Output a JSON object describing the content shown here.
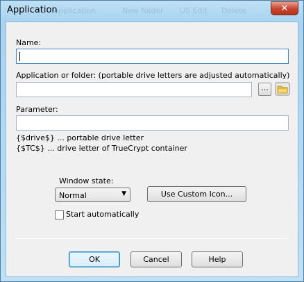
{
  "window": {
    "title": "Application",
    "background_ghost": [
      "Application",
      "New folder",
      "US Edit",
      "Delete"
    ]
  },
  "form": {
    "name_label": "Name:",
    "name_value": "",
    "app_label": "Application or folder:  (portable drive letters are adjusted automatically)",
    "app_value": "",
    "browse_label": "...",
    "param_label": "Parameter:",
    "param_value": "",
    "hint1": "{$drive$} ... portable drive letter",
    "hint2": "{$TC$} ... drive letter of TrueCrypt container",
    "window_state_label": "Window state:",
    "window_state_value": "Normal",
    "custom_icon_label": "Use Custom Icon...",
    "start_auto_label": "Start automatically",
    "start_auto_checked": false
  },
  "buttons": {
    "ok": "OK",
    "cancel": "Cancel",
    "help": "Help"
  },
  "colors": {
    "title_bar": "#a9d3f0",
    "close_button": "#c7432d",
    "focus_border": "#3f86c5"
  },
  "icons": {
    "close": "close-icon",
    "folder": "folder-icon",
    "dropdown": "chevron-down-icon"
  }
}
